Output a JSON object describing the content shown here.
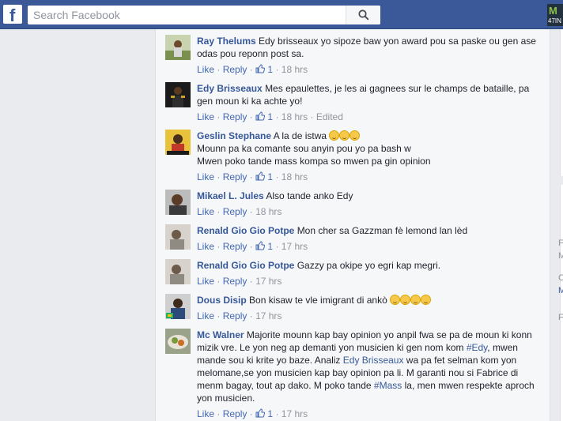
{
  "header": {
    "logo": "f",
    "search_placeholder": "Search Facebook",
    "badge_top": "M",
    "badge_bottom": "47IN"
  },
  "actions": {
    "like": "Like",
    "reply": "Reply",
    "sep": "·"
  },
  "comments": [
    {
      "name": "Ray Thelums",
      "text": "Edy brisseaux yo sipoze baw yon award pou sa paske ou gen ase odas pou reponn post sa.",
      "likes": "1",
      "time": "18 hrs"
    },
    {
      "name": "Edy Brisseaux",
      "text": "Mes epaulettes, je les ai gagnees sur le champs de bataille, pa gen moun ki ka achte yo!",
      "likes": "1",
      "time": "18 hrs",
      "edited": "Edited"
    },
    {
      "name": "Geslin Stephane",
      "text": "A la de istwa",
      "line2": "Mounn pa ka comante sou anyin pou yo pa bash w",
      "line3": "Mwen poko tande mass kompa so mwen pa gin opinion",
      "likes": "1",
      "time": "18 hrs"
    },
    {
      "name": "Mikael L. Jules",
      "text": "Also tande anko Edy",
      "time": "18 hrs"
    },
    {
      "name": "Renald Gio Gio Potpe",
      "text": "Mon cher sa Gazzman fè lemond lan lèd",
      "likes": "1",
      "time": "17 hrs"
    },
    {
      "name": "Renald Gio Gio Potpe",
      "text": "Gazzy pa okipe yo egri kap megri.",
      "time": "17 hrs"
    },
    {
      "name": "Dous Disip",
      "text": "Bon kisaw te vle imigrant di ankò",
      "time": "17 hrs"
    },
    {
      "name": "Mc Walner",
      "text_a": "Majorite mounn kap bay opinion yo anpil fwa se pa de moun ki konn mizik vre. Le yon neg ap demanti yon musicien ki gen nom kom ",
      "tag1": "#Edy",
      "text_b": ", mwen mande sou ki krite yo baze. Analiz ",
      "tag2": "Edy Brisseaux",
      "text_c": " wa pa fet selman kom yon melomane,se yon musicien kap bay opinion pa li. M garanti nou si Fabrice di menm bagay, tout ap dako. M poko tande ",
      "tag3": "#Mass",
      "text_d": " la, men mwen respekte aproch yon musicien.",
      "likes": "1",
      "time": "17 hrs"
    }
  ],
  "right_fragments": [
    "F",
    "M",
    "C",
    "M",
    "F"
  ],
  "colors": {
    "topbar": "#3b5998",
    "link": "#365899",
    "meta": "#90949c"
  }
}
